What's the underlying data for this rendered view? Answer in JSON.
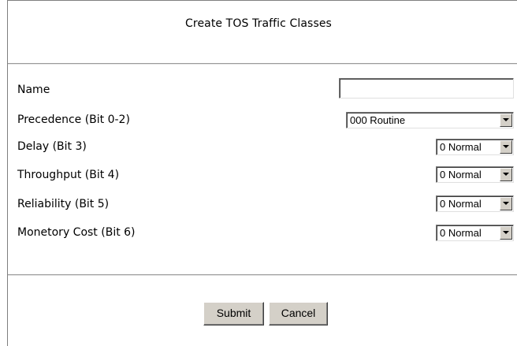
{
  "page": {
    "title": "Create TOS Traffic Classes"
  },
  "form": {
    "name": {
      "label": "Name",
      "value": ""
    },
    "precedence": {
      "label": "Precedence (Bit 0-2)",
      "selected": "000 Routine"
    },
    "delay": {
      "label": "Delay (Bit 3)",
      "selected": "0 Normal"
    },
    "throughput": {
      "label": "Throughput (Bit 4)",
      "selected": "0 Normal"
    },
    "reliability": {
      "label": "Reliability (Bit 5)",
      "selected": "0 Normal"
    },
    "cost": {
      "label": "Monetory Cost (Bit 6)",
      "selected": "0 Normal"
    }
  },
  "buttons": {
    "submit": "Submit",
    "cancel": "Cancel"
  },
  "icons": {
    "dropdown": "chevron-down-icon"
  }
}
